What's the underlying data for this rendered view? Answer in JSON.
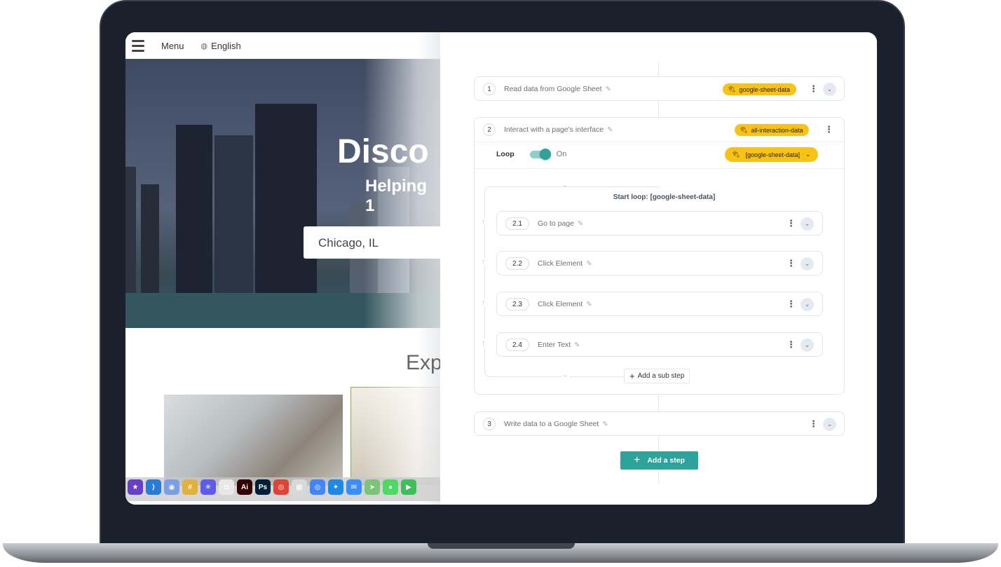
{
  "website": {
    "menu_label": "Menu",
    "language_label": "English",
    "hero_title": "Disco",
    "hero_subtitle": "Helping 1",
    "search_value": "Chicago, IL",
    "section_title": "Exp",
    "dock_apps": [
      {
        "name": "imovie-icon",
        "color": "#6a3fc8",
        "glyph": "★"
      },
      {
        "name": "vscode-icon",
        "color": "#2a7bd4",
        "glyph": "⟩"
      },
      {
        "name": "chromium-icon",
        "color": "#7d9de6",
        "glyph": "◉"
      },
      {
        "name": "slack-icon",
        "color": "#e2b13c",
        "glyph": "#"
      },
      {
        "name": "perplexity-icon",
        "color": "#5c5ce6",
        "glyph": "✳"
      },
      {
        "name": "screenshot-icon",
        "color": "#e8e8e8",
        "glyph": "◘"
      },
      {
        "name": "illustrator-icon",
        "color": "#330000",
        "glyph": "Ai"
      },
      {
        "name": "photoshop-icon",
        "color": "#001e36",
        "glyph": "Ps"
      },
      {
        "name": "chrome-icon",
        "color": "#db4437",
        "glyph": "◎"
      },
      {
        "name": "launchpad-icon",
        "color": "#d8d8d8",
        "glyph": "▦"
      },
      {
        "name": "chrome-beta-icon",
        "color": "#4285f4",
        "glyph": "◎"
      },
      {
        "name": "safari-icon",
        "color": "#1e88e5",
        "glyph": "✦"
      },
      {
        "name": "mail-icon",
        "color": "#3a8ef6",
        "glyph": "✉"
      },
      {
        "name": "maps-icon",
        "color": "#7cc576",
        "glyph": "➤"
      },
      {
        "name": "messages-icon",
        "color": "#4cd964",
        "glyph": "●"
      },
      {
        "name": "facetime-icon",
        "color": "#3fbf5a",
        "glyph": "▶"
      }
    ]
  },
  "workflow": {
    "accent_color": "#2ea39c",
    "tag_color": "#fbc216",
    "steps": [
      {
        "number": "1",
        "title": "Read data from Google Sheet",
        "tag": "google-sheet-data"
      },
      {
        "number": "2",
        "title": "Interact with a page's interface",
        "tag": "all-interaction-data",
        "loop_label": "Loop",
        "loop_state": "On",
        "loop_enabled": true,
        "loop_source": "[google-sheet-data]",
        "loop_title": "Start loop: [google-sheet-data]",
        "substeps": [
          {
            "number": "2.1",
            "title": "Go to page"
          },
          {
            "number": "2.2",
            "title": "Click Element"
          },
          {
            "number": "2.3",
            "title": "Click Element"
          },
          {
            "number": "2.4",
            "title": "Enter Text"
          }
        ],
        "add_substep_label": "Add a sub step"
      },
      {
        "number": "3",
        "title": "Write data to a Google Sheet"
      }
    ],
    "add_step_label": "Add a step"
  }
}
